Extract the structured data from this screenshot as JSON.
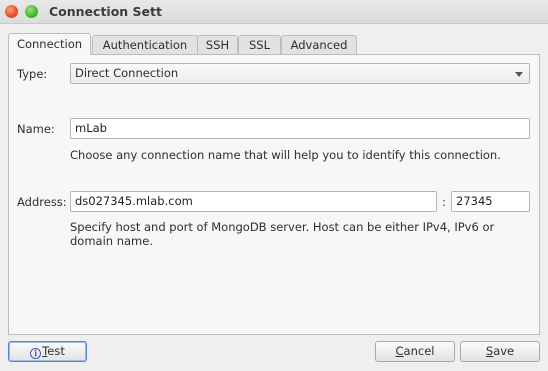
{
  "window": {
    "title": "Connection Settings"
  },
  "tabs": [
    {
      "label": "Connection",
      "active": true
    },
    {
      "label": "Authentication",
      "active": false
    },
    {
      "label": "SSH",
      "active": false
    },
    {
      "label": "SSL",
      "active": false
    },
    {
      "label": "Advanced",
      "active": false
    }
  ],
  "connection": {
    "type_label": "Type:",
    "type_value": "Direct Connection",
    "name_label": "Name:",
    "name_value": "mLab",
    "name_hint": "Choose any connection name that will help you to identify this connection.",
    "address_label": "Address:",
    "host_value": "ds027345.mlab.com",
    "port_separator": ":",
    "port_value": "27345",
    "address_hint": "Specify host and port of MongoDB server. Host can be either IPv4, IPv6 or domain name."
  },
  "buttons": {
    "test": {
      "mnemonic": "T",
      "rest": "est"
    },
    "cancel": {
      "mnemonic": "C",
      "rest": "ancel"
    },
    "save": {
      "mnemonic": "S",
      "rest": "ave"
    }
  },
  "icons": {
    "test_icon": "info-icon"
  }
}
